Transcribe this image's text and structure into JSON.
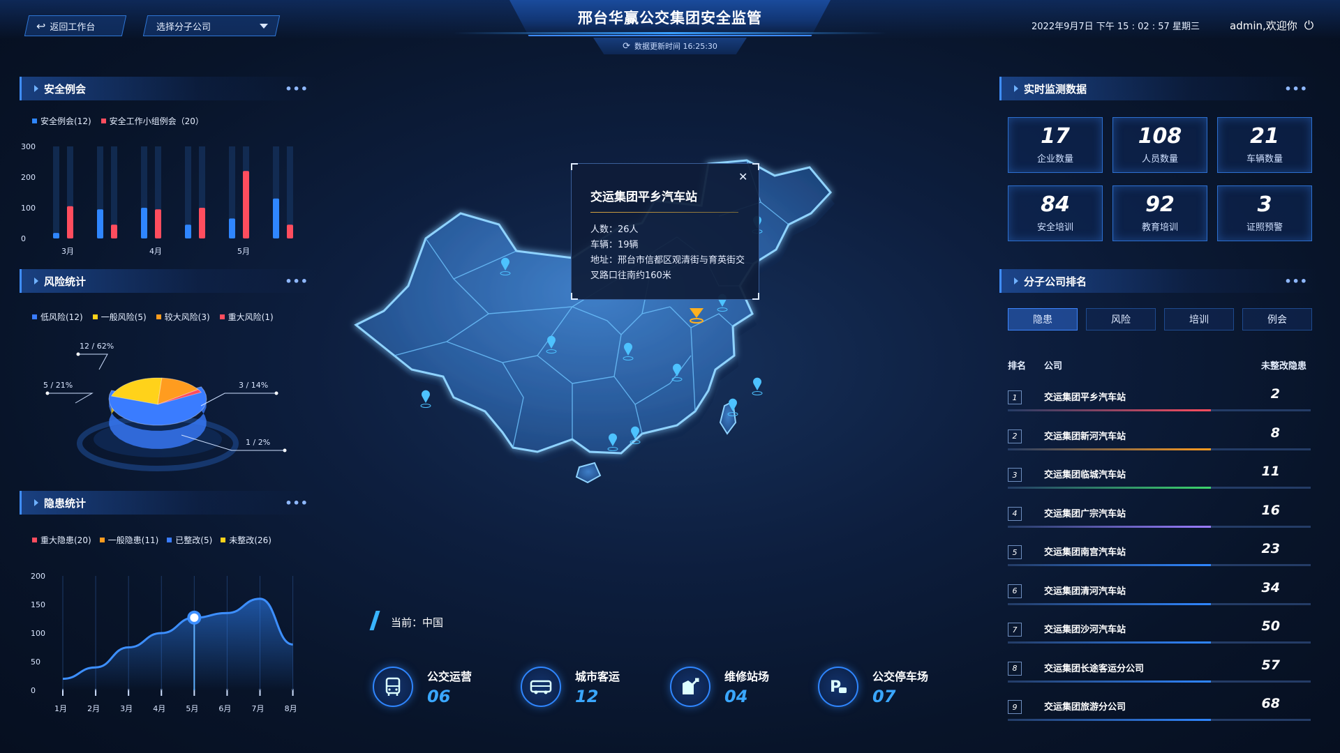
{
  "header": {
    "title": "邢台华赢公交集团安全监管",
    "update_text": "数据更新时间 16:25:30",
    "back_label": "返回工作台",
    "company_select": "选择分子公司",
    "datetime": "2022年9月7日  下午 15 : 02 : 57  星期三",
    "user": "admin,欢迎你"
  },
  "panels": {
    "safety_meeting": {
      "title": "安全例会",
      "more": "•••"
    },
    "risk": {
      "title": "风险统计",
      "more": "•••"
    },
    "hazard": {
      "title": "隐患统计",
      "more": "•••"
    },
    "realtime": {
      "title": "实时监测数据",
      "more": "•••"
    },
    "ranking": {
      "title": "分子公司排名",
      "more": "•••"
    }
  },
  "chart_data": [
    {
      "type": "bar",
      "categories": [
        "3月",
        "4月",
        "5月"
      ],
      "series": [
        {
          "name": "安全例会(12)",
          "color": "#2f86ff",
          "values": [
            [
              18,
              95
            ],
            [
              100,
              45
            ],
            [
              65,
              130
            ]
          ]
        },
        {
          "name": "安全工作小组例会（20）",
          "color": "#ff4d5e",
          "values": [
            [
              105,
              45
            ],
            [
              95,
              100
            ],
            [
              220,
              45
            ]
          ]
        }
      ],
      "yticks": [
        "300",
        "200",
        "100",
        "0"
      ],
      "ylim": [
        0,
        300
      ]
    },
    {
      "type": "pie",
      "legend": [
        {
          "name": "低风险(12)",
          "color": "#3a7cff"
        },
        {
          "name": "一般风险(5)",
          "color": "#ffd21a"
        },
        {
          "name": "较大风险(3)",
          "color": "#ff9c1f"
        },
        {
          "name": "重大风险(1)",
          "color": "#ff4d5e"
        }
      ],
      "slices": [
        {
          "label": "12 / 62%",
          "value": 62,
          "color": "#3a7cff"
        },
        {
          "label": "5 / 21%",
          "value": 21,
          "color": "#ffd21a"
        },
        {
          "label": "3 / 14%",
          "value": 14,
          "color": "#ff9c1f"
        },
        {
          "label": "1 / 2%",
          "value": 2,
          "color": "#ff4d5e"
        }
      ]
    },
    {
      "type": "area",
      "legend": [
        {
          "name": "重大隐患(20)",
          "color": "#ff4d5e"
        },
        {
          "name": "一般隐患(11)",
          "color": "#ff9c1f"
        },
        {
          "name": "已整改(5)",
          "color": "#3a7cff"
        },
        {
          "name": "未整改(26)",
          "color": "#ffd21a"
        }
      ],
      "x": [
        "1月",
        "2月",
        "3月",
        "4月",
        "5月",
        "6月",
        "7月",
        "8月"
      ],
      "values": [
        20,
        40,
        75,
        100,
        127,
        135,
        160,
        80
      ],
      "highlight_index": 4,
      "yticks": [
        "200",
        "150",
        "100",
        "50",
        "0"
      ],
      "ylim": [
        0,
        200
      ]
    }
  ],
  "kpis": [
    {
      "value": "17",
      "label": "企业数量"
    },
    {
      "value": "108",
      "label": "人员数量"
    },
    {
      "value": "21",
      "label": "车辆数量"
    },
    {
      "value": "84",
      "label": "安全培训"
    },
    {
      "value": "92",
      "label": "教育培训"
    },
    {
      "value": "3",
      "label": "证照预警"
    }
  ],
  "tabs": [
    "隐患",
    "风险",
    "培训",
    "例会"
  ],
  "ranking": {
    "headers": {
      "rank": "排名",
      "company": "公司",
      "value": "未整改隐患"
    },
    "rows": [
      {
        "rank": "1",
        "name": "交运集团平乡汽车站",
        "value": "2",
        "color": "#ff4d5e",
        "fill": 0.67
      },
      {
        "rank": "2",
        "name": "交运集团新河汽车站",
        "value": "8",
        "color": "#ff9c1f",
        "fill": 0.67
      },
      {
        "rank": "3",
        "name": "交运集团临城汽车站",
        "value": "11",
        "color": "#3dd46b",
        "fill": 0.67
      },
      {
        "rank": "4",
        "name": "交运集团广宗汽车站",
        "value": "16",
        "color": "#9b7cff",
        "fill": 0.67
      },
      {
        "rank": "5",
        "name": "交运集团南宫汽车站",
        "value": "23",
        "color": "#2f86ff",
        "fill": 0.67
      },
      {
        "rank": "6",
        "name": "交运集团清河汽车站",
        "value": "34",
        "color": "#2f86ff",
        "fill": 0.67
      },
      {
        "rank": "7",
        "name": "交运集团沙河汽车站",
        "value": "50",
        "color": "#2f86ff",
        "fill": 0.67
      },
      {
        "rank": "8",
        "name": "交运集团长途客运分公司",
        "value": "57",
        "color": "#2f86ff",
        "fill": 0.67
      },
      {
        "rank": "9",
        "name": "交运集团旅游分公司",
        "value": "68",
        "color": "#2f86ff",
        "fill": 0.67
      }
    ]
  },
  "popup": {
    "title": "交运集团平乡汽车站",
    "people": "人数：26人",
    "vehicles": "车辆：19辆",
    "address": "地址：邢台市信都区观清街与育英街交叉路口往南约160米"
  },
  "map": {
    "current": "当前：中国"
  },
  "stats": [
    {
      "label": "公交运营",
      "value": "06",
      "icon": "bus-icon"
    },
    {
      "label": "城市客运",
      "value": "12",
      "icon": "coach-icon"
    },
    {
      "label": "维修站场",
      "value": "04",
      "icon": "repair-icon"
    },
    {
      "label": "公交停车场",
      "value": "07",
      "icon": "parking-icon"
    }
  ]
}
